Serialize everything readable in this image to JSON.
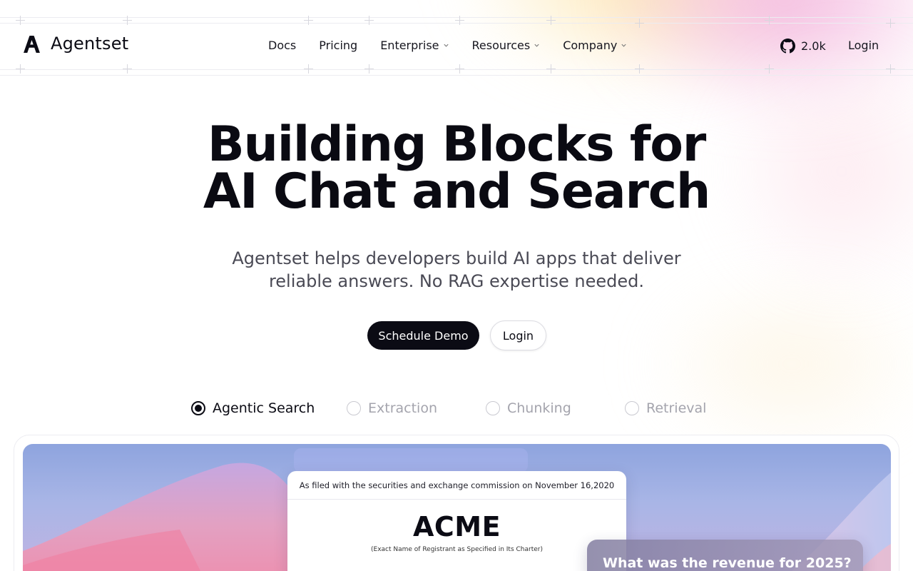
{
  "brand": {
    "name": "Agentset"
  },
  "nav": {
    "items": [
      {
        "label": "Docs",
        "has_dropdown": false
      },
      {
        "label": "Pricing",
        "has_dropdown": false
      },
      {
        "label": "Enterprise",
        "has_dropdown": true
      },
      {
        "label": "Resources",
        "has_dropdown": true
      },
      {
        "label": "Company",
        "has_dropdown": true
      }
    ],
    "github_stars": "2.0k",
    "login_label": "Login"
  },
  "hero": {
    "title_line1": "Building Blocks for",
    "title_line2": "AI Chat and Search",
    "subtitle_line1": "Agentset helps developers build AI apps that deliver",
    "subtitle_line2": "reliable answers. No RAG expertise needed.",
    "primary_cta": "Schedule Demo",
    "secondary_cta": "Login"
  },
  "tabs": [
    {
      "label": "Agentic Search",
      "selected": true
    },
    {
      "label": "Extraction",
      "selected": false
    },
    {
      "label": "Chunking",
      "selected": false
    },
    {
      "label": "Retrieval",
      "selected": false
    }
  ],
  "demo": {
    "document": {
      "filed_note": "As filed with the securities and exchange commission on November 16,2020",
      "company": "ACME",
      "caption": "(Exact Name of Registrant as Specified in Its Charter)"
    },
    "question": "What was the revenue for 2025?"
  },
  "colors": {
    "primary": "#0b0b14",
    "muted_text": "#a4a4ad",
    "scene_sky": "#8ea4de",
    "accent_pink": "#f3b6de",
    "accent_yellow": "#fde7b0"
  },
  "icons": {
    "logo": "agentset-logo-icon",
    "github": "github-icon",
    "dropdown": "chevron-down-icon"
  }
}
